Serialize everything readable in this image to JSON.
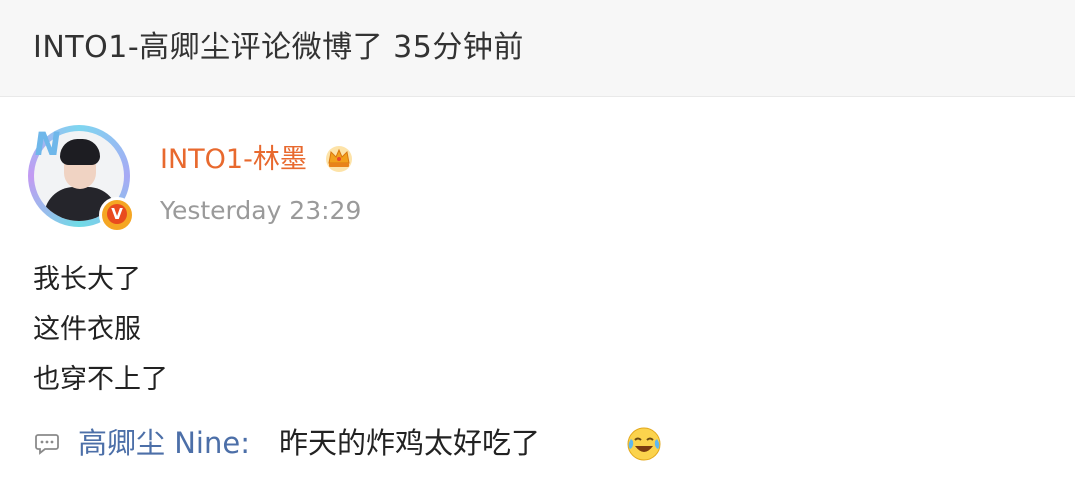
{
  "header": {
    "title": "INTO1-高卿尘评论微博了 35分钟前"
  },
  "post": {
    "user_name": "INTO1-林墨",
    "time": "Yesterday 23:29",
    "lines": [
      "我长大了",
      "这件衣服",
      "也穿不上了"
    ],
    "avatar_icon": "avatar-with-brand-frame",
    "verified_label": "V",
    "badge_icon": "crown-icon"
  },
  "comment": {
    "author": "高卿尘 Nine:",
    "text": "昨天的炸鸡太好吃了",
    "icon": "comment-bubble-icon",
    "emoji": "laugh-cry-emoji"
  },
  "colors": {
    "user_name": "#e8692e",
    "comment_author": "#4c6fa8",
    "time": "#9a9a9a",
    "header_bg": "#f7f7f7"
  }
}
